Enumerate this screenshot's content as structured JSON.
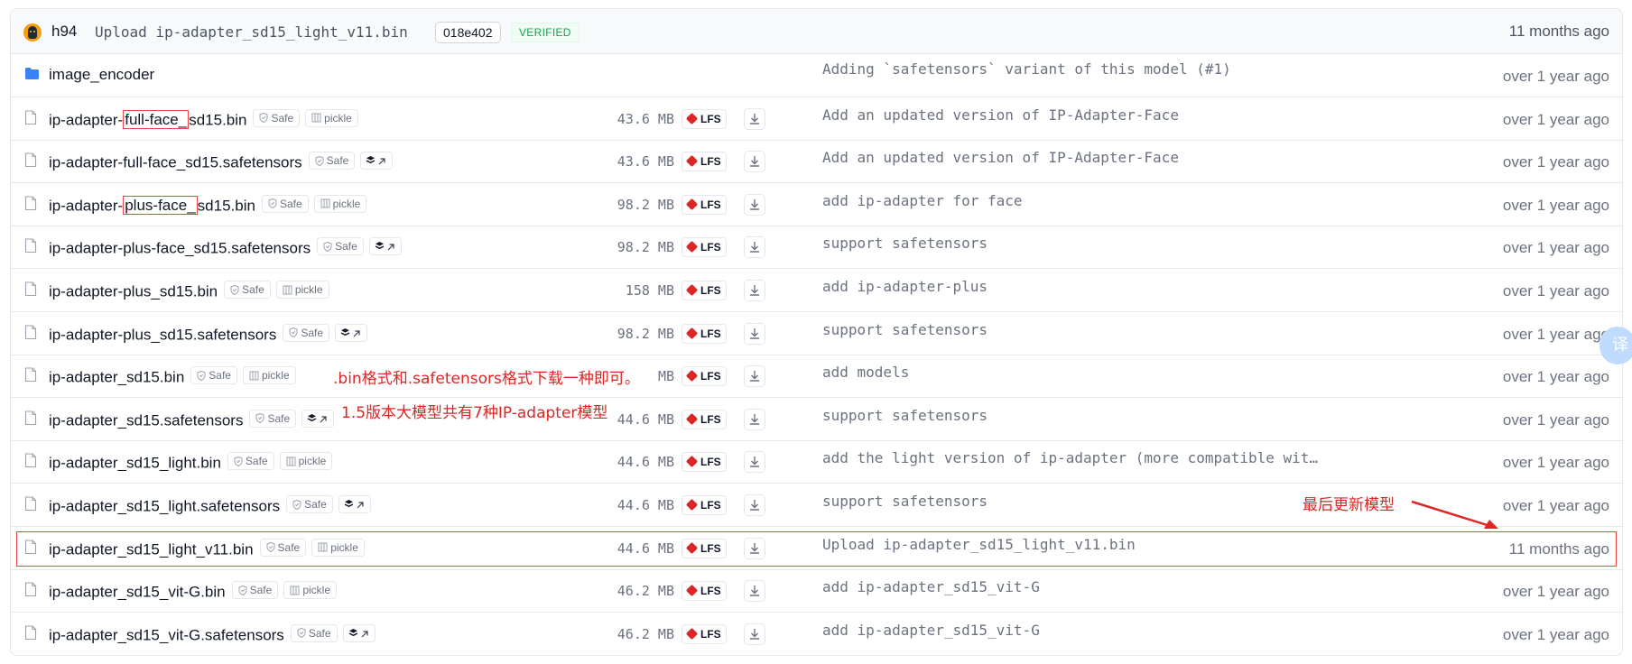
{
  "header": {
    "author": "h94",
    "commit_message": "Upload ip-adapter_sd15_light_v11.bin",
    "sha": "018e402",
    "verified": "VERIFIED",
    "time": "11 months ago"
  },
  "files": [
    {
      "name_parts": [
        "image_encoder"
      ],
      "type": "folder",
      "size": "",
      "lfs": false,
      "badges": [],
      "message": "Adding `safetensors` variant of this model (#1)",
      "time": "over 1 year ago"
    },
    {
      "name_parts": [
        "ip-adapter-",
        "full-face_",
        "sd15.bin"
      ],
      "type": "file",
      "size": "43.6 MB",
      "lfs": true,
      "badges": [
        "Safe",
        "pickle"
      ],
      "message": "Add an updated version of IP-Adapter-Face",
      "time": "over 1 year ago"
    },
    {
      "name_parts": [
        "ip-adapter-full-face_sd15.safetensors"
      ],
      "type": "file",
      "size": "43.6 MB",
      "lfs": true,
      "badges": [
        "Safe",
        "stack"
      ],
      "message": "Add an updated version of IP-Adapter-Face",
      "time": "over 1 year ago"
    },
    {
      "name_parts": [
        "ip-adapter-",
        "plus-face_",
        "sd15.bin"
      ],
      "type": "file",
      "size": "98.2 MB",
      "lfs": true,
      "badges": [
        "Safe",
        "pickle"
      ],
      "message": "add ip-adapter for face",
      "time": "over 1 year ago"
    },
    {
      "name_parts": [
        "ip-adapter-plus-face_sd15.safetensors"
      ],
      "type": "file",
      "size": "98.2 MB",
      "lfs": true,
      "badges": [
        "Safe",
        "stack"
      ],
      "message": "support safetensors",
      "time": "over 1 year ago"
    },
    {
      "name_parts": [
        "ip-adapter-plus_sd15.bin"
      ],
      "type": "file",
      "size": "158 MB",
      "lfs": true,
      "badges": [
        "Safe",
        "pickle"
      ],
      "message": "add ip-adapter-plus",
      "time": "over 1 year ago"
    },
    {
      "name_parts": [
        "ip-adapter-plus_sd15.safetensors"
      ],
      "type": "file",
      "size": "98.2 MB",
      "lfs": true,
      "badges": [
        "Safe",
        "stack"
      ],
      "message": "support safetensors",
      "time": "over 1 year ago"
    },
    {
      "name_parts": [
        "ip-adapter_sd15.bin"
      ],
      "type": "file",
      "size": "MB",
      "lfs": true,
      "badges": [
        "Safe",
        "pickle"
      ],
      "message": "add models",
      "time": "over 1 year ago"
    },
    {
      "name_parts": [
        "ip-adapter_sd15.safetensors"
      ],
      "type": "file",
      "size": "44.6 MB",
      "lfs": true,
      "badges": [
        "Safe",
        "stack"
      ],
      "message": "support safetensors",
      "time": "over 1 year ago"
    },
    {
      "name_parts": [
        "ip-adapter_sd15_light.bin"
      ],
      "type": "file",
      "size": "44.6 MB",
      "lfs": true,
      "badges": [
        "Safe",
        "pickle"
      ],
      "message": "add the light version of ip-adapter (more compatible wit…",
      "time": "over 1 year ago"
    },
    {
      "name_parts": [
        "ip-adapter_sd15_light.safetensors"
      ],
      "type": "file",
      "size": "44.6 MB",
      "lfs": true,
      "badges": [
        "Safe",
        "stack"
      ],
      "message": "support safetensors",
      "time": "over 1 year ago"
    },
    {
      "name_parts": [
        "ip-adapter_sd15_light_v11.bin"
      ],
      "type": "file",
      "size": "44.6 MB",
      "lfs": true,
      "badges": [
        "Safe",
        "pickle"
      ],
      "message": "Upload ip-adapter_sd15_light_v11.bin",
      "time": "11 months ago"
    },
    {
      "name_parts": [
        "ip-adapter_sd15_vit-G.bin"
      ],
      "type": "file",
      "size": "46.2 MB",
      "lfs": true,
      "badges": [
        "Safe",
        "pickle"
      ],
      "message": "add ip-adapter_sd15_vit-G",
      "time": "over 1 year ago"
    },
    {
      "name_parts": [
        "ip-adapter_sd15_vit-G.safetensors"
      ],
      "type": "file",
      "size": "46.2 MB",
      "lfs": true,
      "badges": [
        "Safe",
        "stack"
      ],
      "message": "add ip-adapter_sd15_vit-G",
      "time": "over 1 year ago"
    }
  ],
  "labels": {
    "lfs": "LFS"
  },
  "annotations": {
    "format_note": ".bin格式和.safetensors格式下载一种即可。",
    "count_note": "1.5版本大模型共有7种IP-adapter模型",
    "latest_note": "最后更新模型"
  },
  "side_widget": {
    "text": "译"
  },
  "colors": {
    "annotation": "#dc2626",
    "folder": "#3b82f6",
    "verified": "#16a34a",
    "lfs_icon": "#dc2626"
  }
}
